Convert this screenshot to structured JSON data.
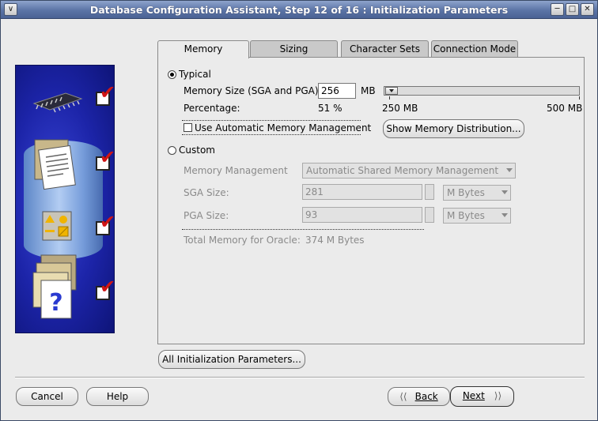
{
  "window": {
    "title": "Database Configuration Assistant, Step 12 of 16 : Initialization Parameters"
  },
  "tabs": [
    {
      "label": "Memory",
      "active": true
    },
    {
      "label": "Sizing",
      "active": false
    },
    {
      "label": "Character Sets",
      "active": false
    },
    {
      "label": "Connection Mode",
      "active": false
    }
  ],
  "memory": {
    "typical_label": "Typical",
    "memory_size_label": "Memory Size (SGA and PGA):",
    "memory_size_value": "256",
    "memory_size_unit": "MB",
    "percentage_label": "Percentage:",
    "percentage_value": "51 %",
    "slider_min": "250 MB",
    "slider_max": "500 MB",
    "slider_fraction": 0.02,
    "auto_mm_label": "Use Automatic Memory Management",
    "show_distribution_button": "Show Memory Distribution...",
    "custom_label": "Custom",
    "memory_management_label": "Memory Management",
    "memory_management_value": "Automatic Shared Memory Management",
    "sga_size_label": "SGA Size:",
    "sga_size_value": "281",
    "sga_unit": "M Bytes",
    "pga_size_label": "PGA Size:",
    "pga_size_value": "93",
    "pga_unit": "M Bytes",
    "total_memory_label": "Total Memory for Oracle:",
    "total_memory_value": "374 M Bytes"
  },
  "buttons": {
    "all_params": "All Initialization Parameters...",
    "cancel": "Cancel",
    "help": "Help",
    "back": "Back",
    "next": "Next"
  },
  "colors": {
    "title_bar": "#5b74a6",
    "graphic_panel": "#1c24a8",
    "check_red": "#d01515"
  }
}
